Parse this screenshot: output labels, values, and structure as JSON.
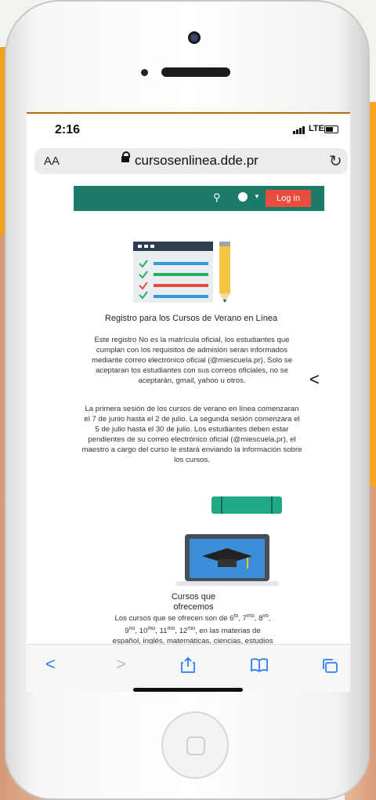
{
  "status_bar": {
    "time": "2:16",
    "network": "LTE"
  },
  "browser": {
    "text_size_label": "AA",
    "url": "cursosenlinea.dde.pr",
    "reload_icon": "reload-icon"
  },
  "site_nav": {
    "search_icon": "search-icon",
    "globe_icon": "globe-icon",
    "login_label": "Log in",
    "bar_color": "#1b7a68",
    "login_color": "#e74c3c"
  },
  "registration": {
    "title": "Registro para los Cursos de Verano en Línea",
    "paragraph_1": "Este registro No es la matrícula oficial, los estudiantes que cumplan con los requisitos de admisión seran informados mediante correo electronico oficial (@miescuela.pr), Solo se aceptaran los estudiantes con sus correos oficiales, no se aceptarán, gmail, yahoo u otros.",
    "paragraph_2": "La primera sesión de los cursos de verano en línea comenzaran el 7 de junio hasta el 2 de julio. La segunda sesión comenzara el 5 de julio hasta el 30 de julio. Los estudiantes deben estar pendientes de su correo electrónico oficial (@miescuela.pr), el maestro a cargo del curso le estará enviando la información sobre los cursos."
  },
  "courses": {
    "title_line_1": "Cursos que",
    "title_line_2": "ofrecemos",
    "line_1_prefix": "Los cursos que se ofrecen son de 6",
    "line_1_items": [
      {
        "n": "6",
        "sup": "to"
      },
      {
        "n": "7",
        "sup": "mo"
      },
      {
        "n": "8",
        "sup": "vo"
      }
    ],
    "line_2_items": [
      {
        "n": "9",
        "sup": "no"
      },
      {
        "n": "10",
        "sup": "mo"
      },
      {
        "n": "11",
        "sup": "mo"
      },
      {
        "n": "12",
        "sup": "mo"
      }
    ],
    "line_2_suffix": ", en las materias de",
    "line_3": "español, inglés, matemáticas, ciencias, estudios"
  },
  "toolbar": {
    "back": "back-icon",
    "forward": "forward-icon",
    "share": "share-icon",
    "bookmarks": "book-icon",
    "tabs": "tabs-icon",
    "accent": "#2f7cf6"
  }
}
